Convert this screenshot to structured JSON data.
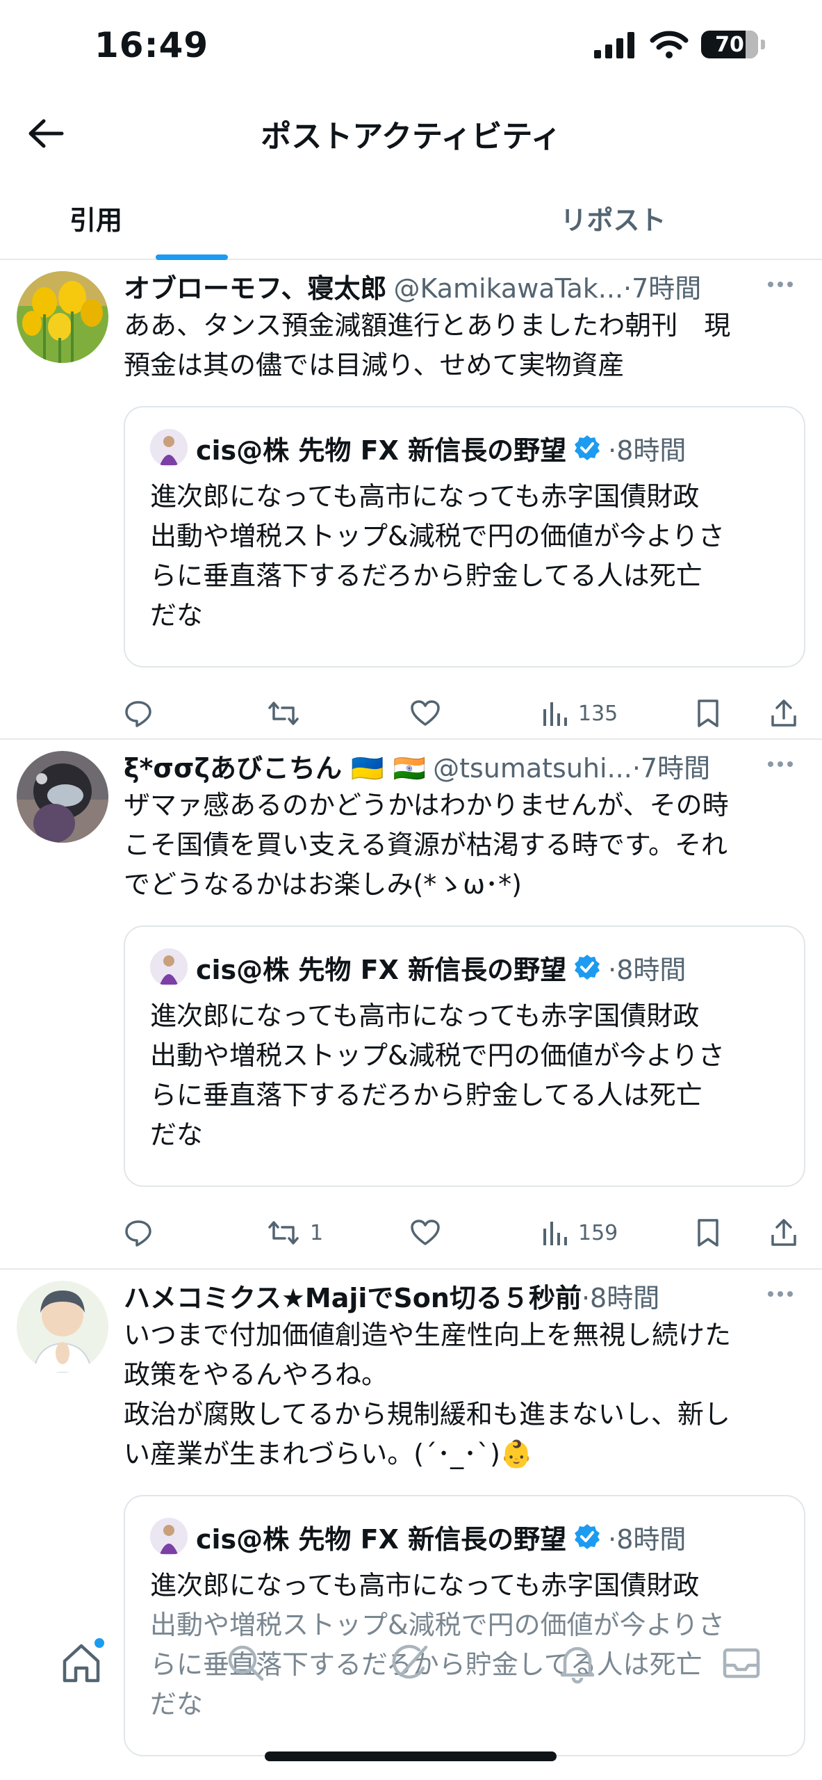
{
  "status": {
    "time": "16:49",
    "battery": "70"
  },
  "header": {
    "title": "ポストアクティビティ"
  },
  "tabs": [
    {
      "label": "引用"
    },
    {
      "label": "リポスト"
    }
  ],
  "posts": [
    {
      "name": "オブローモフ、寝太郎",
      "handle": "@KamikawaTak...",
      "time": "·7時間",
      "lines": [
        "ああ、タンス預金減額進行とありましたわ朝刊　現",
        "預金は其の儘では目減り、せめて実物資産"
      ],
      "quote": {
        "name": "cis@株 先物 FX 新信長の野望",
        "time": "·8時間",
        "lines": [
          "進次郎になっても高市になっても赤字国債財政",
          "出動や増税ストップ&減税で円の価値が今よりさ",
          "らに垂直落下するだろから貯金してる人は死亡",
          "だな"
        ]
      },
      "reposts": "",
      "views": "135"
    },
    {
      "name": "ξ*σσζあびこちん 🇺🇦 🇮🇳",
      "handle": "@tsumatsuhi...",
      "time": "·7時間",
      "lines": [
        "ザマァ感あるのかどうかはわかりませんが、その時",
        "こそ国債を買い支える資源が枯渇する時です。それ",
        "でどうなるかはお楽しみ(*ゝω･*)"
      ],
      "quote": {
        "name": "cis@株 先物 FX 新信長の野望",
        "time": "·8時間",
        "lines": [
          "進次郎になっても高市になっても赤字国債財政",
          "出動や増税ストップ&減税で円の価値が今よりさ",
          "らに垂直落下するだろから貯金してる人は死亡",
          "だな"
        ]
      },
      "reposts": "1",
      "views": "159"
    },
    {
      "name": "ハメコミクス★MajiでSon切る５秒前",
      "handle": "",
      "time": "·8時間",
      "lines": [
        "いつまで付加価値創造や生産性向上を無視し続けた",
        "政策をやるんやろね。",
        "政治が腐敗してるから規制緩和も進まないし、新し",
        "い産業が生まれづらい。(´･_･`)👶"
      ],
      "quote": {
        "name": "cis@株 先物 FX 新信長の野望",
        "time": "·8時間",
        "lines": [
          "進次郎になっても高市になっても赤字国債財政",
          "出動や増税ストップ&減税で円の価値が今よりさ",
          "らに垂直落下するだろから貯金してる人は死亡",
          "だな"
        ]
      }
    }
  ],
  "icons": {
    "back": "arrow-left-icon",
    "more": "more-icon",
    "verified": "verified-badge-icon",
    "reply": "reply-icon",
    "repost": "repost-icon",
    "like": "heart-icon",
    "views": "views-chart-icon",
    "bookmark": "bookmark-icon",
    "share": "share-icon",
    "nav": [
      "home-icon",
      "search-icon",
      "grok-icon",
      "bell-icon",
      "mail-icon"
    ]
  },
  "colors": {
    "accent": "#1d9bf0",
    "text": "#0f1419",
    "muted": "#536471",
    "divider": "#e7e9ea"
  }
}
